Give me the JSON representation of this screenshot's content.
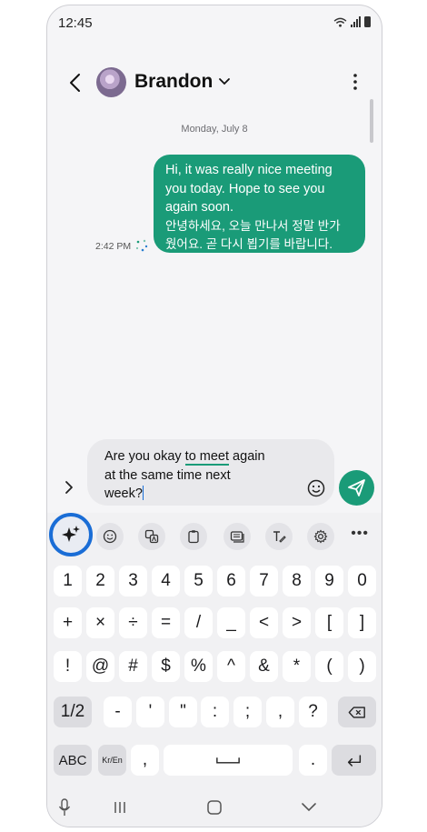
{
  "status_bar": {
    "time": "12:45",
    "icons": [
      "wifi-icon",
      "signal-icon",
      "battery-icon"
    ]
  },
  "header": {
    "contact_name": "Brandon",
    "icons": [
      "back-arrow-icon",
      "avatar",
      "chevron-down-icon",
      "more-vertical-icon"
    ]
  },
  "conversation": {
    "date_label": "Monday, July 8",
    "message": {
      "text_en": [
        "Hi, it was really nice meeting",
        "you today. Hope to see you",
        "again soon."
      ],
      "text_ko": [
        "안녕하세요, 오늘 만나서 정말 반가",
        "웠어요. 곧 다시 뵙기를 바랍니다."
      ],
      "time": "2:42 PM",
      "bubble_color": "#1a9b78"
    }
  },
  "composer": {
    "line1_start": "Are you okay ",
    "line1_underlined": "to meet",
    "line1_end": " again",
    "line2": "at the same time next",
    "line3": "week?",
    "icons": [
      "expand-arrow-icon",
      "emoji-icon",
      "send-icon"
    ]
  },
  "keyboard_toolbar": {
    "tools": [
      "ai-sparkle-icon",
      "emoji-icon",
      "translate-icon",
      "clipboard-icon",
      "keyboard-mode-icon",
      "handwriting-icon",
      "settings-gear-icon"
    ],
    "more": "•••",
    "accent": "#1a6dd6"
  },
  "keyboard": {
    "row1": [
      "1",
      "2",
      "3",
      "4",
      "5",
      "6",
      "7",
      "8",
      "9",
      "0"
    ],
    "row2": [
      "+",
      "×",
      "÷",
      "=",
      "/",
      "_",
      "<",
      ">",
      "[",
      "]"
    ],
    "row3": [
      "!",
      "@",
      "#",
      "$",
      "%",
      "^",
      "&",
      "*",
      "(",
      ")"
    ],
    "row4": [
      "1/2",
      "-",
      "'",
      "\"",
      ":",
      ";",
      ",",
      "?"
    ],
    "row5": [
      "ABC",
      "Kr/En",
      ",",
      "."
    ],
    "icons": [
      "backspace-icon",
      "space-icon",
      "enter-icon"
    ]
  },
  "nav_bar": {
    "icons": [
      "mic-icon",
      "recents-icon",
      "home-icon",
      "back-icon"
    ]
  }
}
